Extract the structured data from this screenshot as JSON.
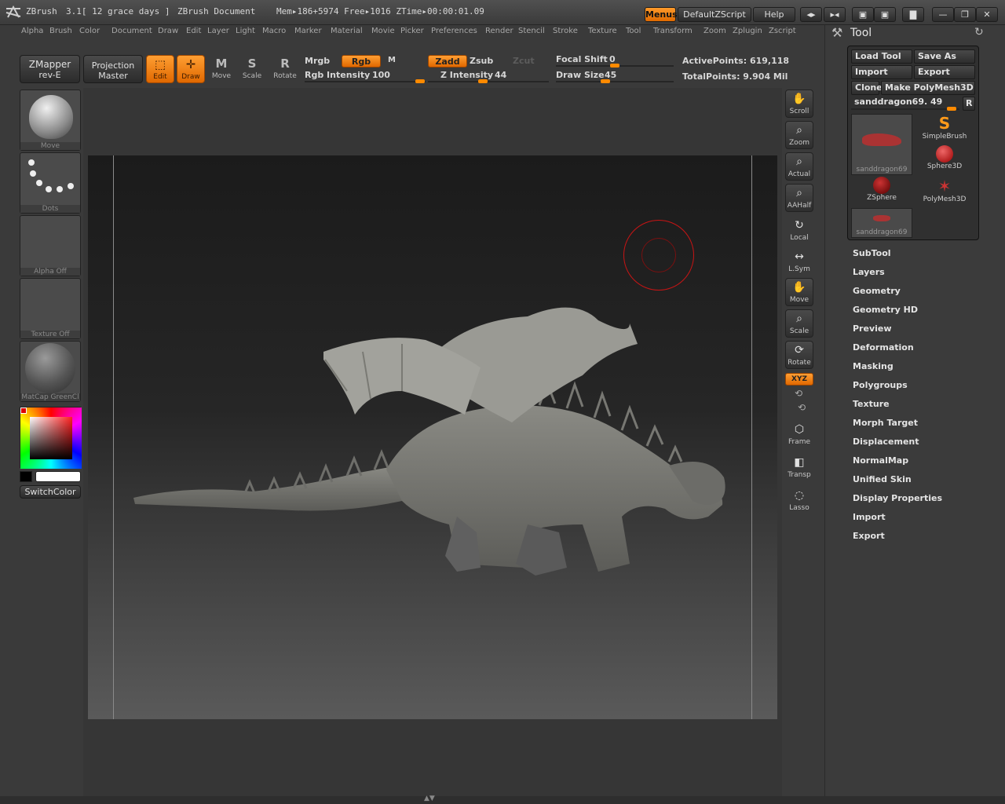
{
  "titlebar": {
    "app": "ZBrush",
    "version": "3.1[ 12 grace days ]",
    "document": "ZBrush Document",
    "mem": "Mem▸186+5974 Free▸1016 ZTime▸00:00:01.09",
    "menus_btn": "Menus",
    "script_btn": "DefaultZScript",
    "help_btn": "Help"
  },
  "menubar": [
    "Alpha",
    "Brush",
    "Color",
    "Document",
    "Draw",
    "Edit",
    "Layer",
    "Light",
    "Macro",
    "Marker",
    "Material",
    "Movie",
    "Picker",
    "Preferences",
    "Render",
    "Stencil",
    "Stroke",
    "Texture",
    "Tool",
    "Transform",
    "Zoom",
    "Zplugin",
    "Zscript"
  ],
  "toolbar": {
    "zmapper_line1": "ZMapper",
    "zmapper_line2": "rev-E",
    "projection_line1": "Projection",
    "projection_line2": "Master",
    "edit": "Edit",
    "draw": "Draw",
    "move": "Move",
    "scale": "Scale",
    "rotate": "Rotate",
    "move_glyph": "M",
    "scale_glyph": "S",
    "rotate_glyph": "R",
    "mrgb": "Mrgb",
    "rgb": "Rgb",
    "m": "M",
    "rgb_intensity_label": "Rgb Intensity",
    "rgb_intensity": "100",
    "zadd": "Zadd",
    "zsub": "Zsub",
    "zcut": "Zcut",
    "z_intensity_label": "Z Intensity",
    "z_intensity": "44",
    "focal_shift_label": "Focal Shift",
    "focal_shift": "0",
    "draw_size_label": "Draw Size",
    "draw_size": "45",
    "active_points": "ActivePoints: 619,118",
    "total_points": "TotalPoints: 9.904 Mil"
  },
  "leftshelf": {
    "brush": "Move",
    "stroke": "Dots",
    "alpha": "Alpha  Off",
    "texture": "Texture  Off",
    "material": "MatCap  GreenCl",
    "switchcolor": "SwitchColor"
  },
  "rightshelf": [
    "Scroll",
    "Zoom",
    "Actual",
    "AAHalf",
    "Local",
    "L.Sym",
    "Move",
    "Scale",
    "Rotate",
    "XYZ",
    "Frame",
    "Transp",
    "Lasso"
  ],
  "toolpanel": {
    "title": "Tool",
    "load_tool": "Load Tool",
    "save_as": "Save As",
    "import": "Import",
    "export": "Export",
    "clone": "Clone",
    "make_polymesh": "Make PolyMesh3D",
    "current_tool": "sanddragon69. 49",
    "r": "R",
    "tools": [
      "sanddragon69",
      "SimpleBrush",
      "Sphere3D",
      "ZSphere",
      "PolyMesh3D",
      "sanddragon69"
    ],
    "sections": [
      "SubTool",
      "Layers",
      "Geometry",
      "Geometry HD",
      "Preview",
      "Deformation",
      "Masking",
      "Polygroups",
      "Texture",
      "Morph Target",
      "Displacement",
      "NormalMap",
      "Unified Skin",
      "Display Properties",
      "Import",
      "Export"
    ]
  },
  "colors": {
    "accent": "#ff8a00",
    "brush_ring": "#c81414"
  },
  "icons": [
    "zbrush-logo-icon",
    "scroll-icon",
    "zoom-icon",
    "actual-icon",
    "aahalf-icon",
    "local-icon",
    "lsym-icon",
    "move-icon",
    "scale-icon",
    "rotate-icon",
    "frame-icon",
    "transp-icon",
    "lasso-icon",
    "minimize-icon",
    "maximize-icon",
    "close-icon",
    "refresh-icon",
    "hammer-icon",
    "lock-icon"
  ]
}
